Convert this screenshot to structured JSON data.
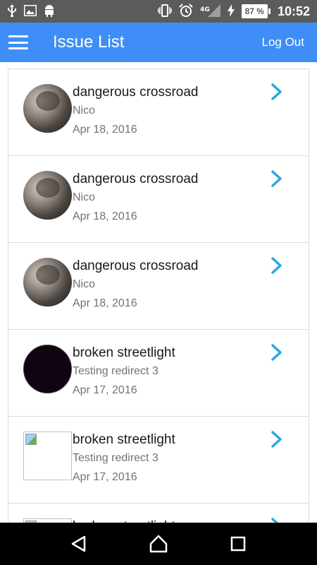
{
  "status_bar": {
    "icons": [
      "usb-icon",
      "image-icon",
      "android-icon",
      "vibrate-icon",
      "alarm-icon",
      "signal-icon",
      "charging-icon"
    ],
    "network": "4G",
    "battery": "87 %",
    "time": "10:52"
  },
  "app_bar": {
    "title": "Issue List",
    "logout_label": "Log Out"
  },
  "issues": [
    {
      "title": "dangerous crossroad",
      "subtitle": "Nico",
      "date": "Apr 18, 2016",
      "avatar": "photo"
    },
    {
      "title": "dangerous crossroad",
      "subtitle": "Nico",
      "date": "Apr 18, 2016",
      "avatar": "photo"
    },
    {
      "title": "dangerous crossroad",
      "subtitle": "Nico",
      "date": "Apr 18, 2016",
      "avatar": "photo"
    },
    {
      "title": "broken streetlight",
      "subtitle": "Testing redirect 3",
      "date": "Apr 17, 2016",
      "avatar": "dark"
    },
    {
      "title": "broken streetlight",
      "subtitle": "Testing redirect 3",
      "date": "Apr 17, 2016",
      "avatar": "broken-image"
    },
    {
      "title": "broken streetlight",
      "subtitle": "",
      "date": "",
      "avatar": "broken-image"
    }
  ],
  "colors": {
    "app_bar": "#3f8ef7",
    "chevron": "#29a8e0",
    "status_bar": "#5b5b5b",
    "nav_bar": "#000000"
  },
  "nav_bar": {
    "buttons": [
      "back-icon",
      "home-icon",
      "recents-icon"
    ]
  }
}
